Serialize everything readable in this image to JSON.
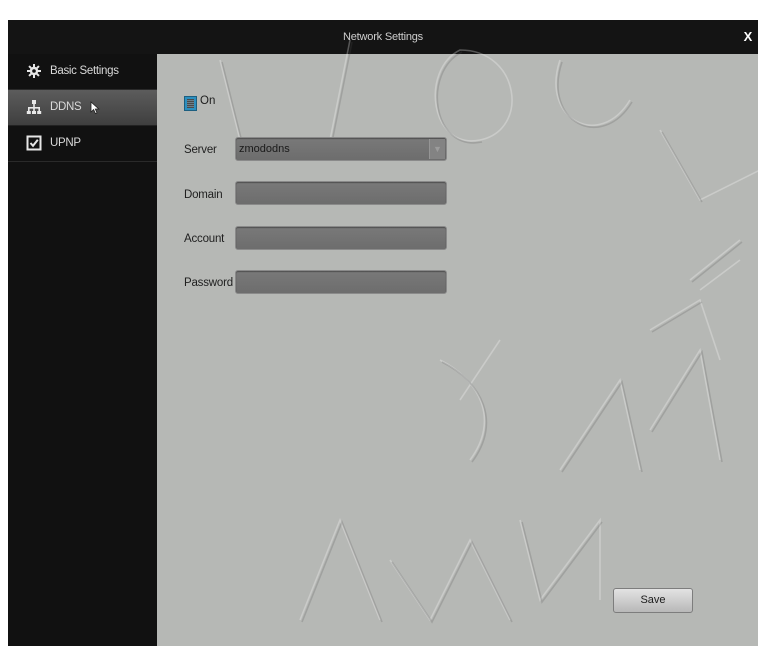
{
  "window": {
    "title": "Network Settings",
    "close_label": "X"
  },
  "sidebar": {
    "items": [
      {
        "label": "Basic Settings",
        "icon": "gear-icon",
        "active": false
      },
      {
        "label": "DDNS",
        "icon": "network-icon",
        "active": true
      },
      {
        "label": "UPNP",
        "icon": "checkbox-icon",
        "active": false
      }
    ]
  },
  "form": {
    "toggle": {
      "label": "On",
      "checked": true
    },
    "server": {
      "label": "Server",
      "value": "zmododns"
    },
    "domain": {
      "label": "Domain",
      "value": ""
    },
    "account": {
      "label": "Account",
      "value": ""
    },
    "password": {
      "label": "Password",
      "value": ""
    }
  },
  "actions": {
    "save_label": "Save"
  },
  "colors": {
    "accent": "#2c8fbf",
    "titlebar": "#141414",
    "content_bg": "#b6b8b5"
  }
}
